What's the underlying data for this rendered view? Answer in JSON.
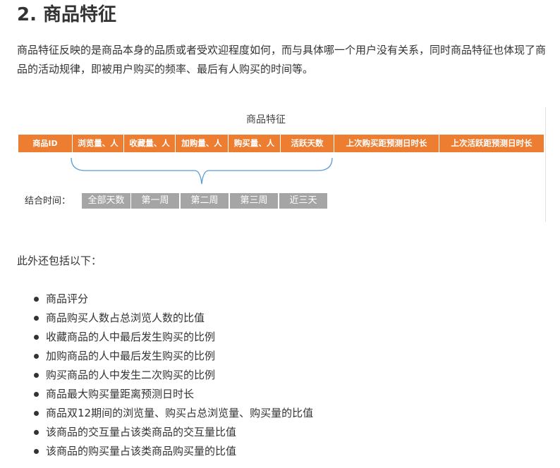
{
  "heading": "2. 商品特征",
  "paragraph": "商品特征反映的是商品本身的品质或者受欢迎程度如何，而与具体哪一个用户没有关系，同时商品特征也体现了商品的活动规律，即被用户购买的频率、最后有人购买的时间等。",
  "figure": {
    "title": "商品特征",
    "features": [
      "商品ID",
      "浏览量、人",
      "收藏量、人",
      "加购量、人",
      "购买量、人",
      "活跃天数",
      "上次购买距预测日时长",
      "上次活跃距预测日时长"
    ],
    "combine_label": "结合时间：",
    "periods": [
      "全部天数",
      "第一周",
      "第二周",
      "第三周",
      "近三天"
    ],
    "colors": {
      "feature_bar": "#ed7d31",
      "period_bar": "#a5a5a5",
      "brace": "#5b9bd5"
    }
  },
  "intro": "此外还包括以下：",
  "items": [
    "商品评分",
    "商品购买人数占总浏览人数的比值",
    "收藏商品的人中最后发生购买的比例",
    "加购商品的人中最后发生购买的比例",
    "购买商品的人中发生二次购买的比例",
    "商品最大购买量距离预测日时长",
    "商品双12期间的浏览量、购买占总浏览量、购买量的比值",
    "该商品的交互量占该类商品的交互量比值",
    "该商品的购买量占该类商品购买量的比值"
  ]
}
